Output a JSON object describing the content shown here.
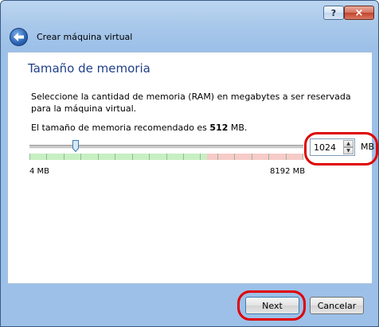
{
  "titlebar": {
    "help_label": "?",
    "close_label": "×"
  },
  "header": {
    "title": "Crear máquina virtual"
  },
  "page": {
    "heading": "Tamaño de memoria",
    "description": "Seleccione la cantidad de memoria (RAM) en megabytes a ser reservada para la máquina virtual.",
    "recommend_prefix": "El tamaño de memoria recomendado es ",
    "recommend_value": "512",
    "recommend_suffix": " MB."
  },
  "memory": {
    "value": "1024",
    "unit": "MB",
    "min_label": "4 MB",
    "max_label": "8192 MB",
    "min_mb": 4,
    "max_mb": 8192,
    "current_mb": 1024
  },
  "footer": {
    "next_label": "Next",
    "cancel_label": "Cancelar"
  },
  "colors": {
    "annotation": "#e00000",
    "heading": "#1f3f8a",
    "safe_range": "#c7f0c2",
    "danger_range": "#f6cbc8"
  }
}
